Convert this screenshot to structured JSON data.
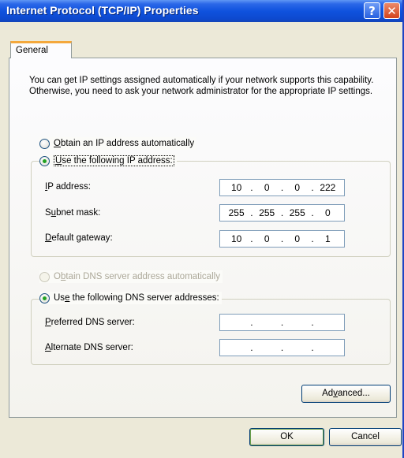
{
  "window": {
    "title": "Internet Protocol (TCP/IP) Properties",
    "help_glyph": "?",
    "close_glyph": "✕"
  },
  "tabs": [
    {
      "label": "General",
      "selected": true
    }
  ],
  "intro_text": "You can get IP settings assigned automatically if your network supports this capability. Otherwise, you need to ask your network administrator for the appropriate IP settings.",
  "ip": {
    "auto_option": {
      "pre": "",
      "ul": "O",
      "post": "btain an IP address automatically",
      "checked": false
    },
    "manual_option": {
      "pre": "",
      "ul": "U",
      "post": "se the following IP address:",
      "checked": true
    },
    "fields": [
      {
        "pre": "",
        "ul": "I",
        "post": "P address:",
        "octets": [
          "10",
          "0",
          "0",
          "222"
        ]
      },
      {
        "pre": "S",
        "ul": "u",
        "post": "bnet mask:",
        "octets": [
          "255",
          "255",
          "255",
          "0"
        ]
      },
      {
        "pre": "",
        "ul": "D",
        "post": "efault gateway:",
        "octets": [
          "10",
          "0",
          "0",
          "1"
        ]
      }
    ]
  },
  "dns": {
    "auto_option": {
      "pre": "O",
      "ul": "b",
      "post": "tain DNS server address automatically",
      "checked": false,
      "disabled": true
    },
    "manual_option": {
      "pre": "Us",
      "ul": "e",
      "post": " the following DNS server addresses:",
      "checked": true
    },
    "fields": [
      {
        "pre": "",
        "ul": "P",
        "post": "referred DNS server:",
        "octets": [
          "",
          "",
          "",
          ""
        ]
      },
      {
        "pre": "",
        "ul": "A",
        "post": "lternate DNS server:",
        "octets": [
          "",
          "",
          "",
          ""
        ]
      }
    ]
  },
  "buttons": {
    "advanced": {
      "pre": "Ad",
      "ul": "v",
      "post": "anced..."
    },
    "ok": "OK",
    "cancel": "Cancel"
  },
  "ip_separator": "."
}
